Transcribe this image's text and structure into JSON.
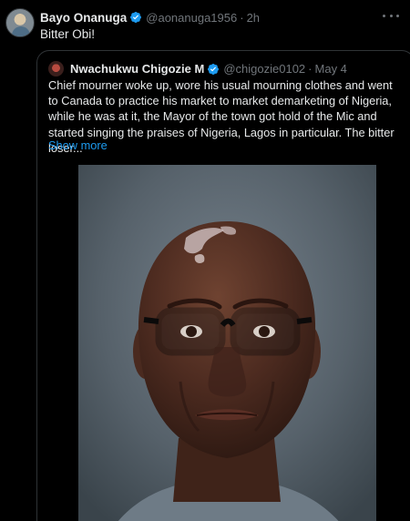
{
  "tweet": {
    "author_name": "Bayo Onanuga",
    "author_handle": "@aonanuga1956",
    "separator": "·",
    "time": "2h",
    "text": "Bitter Obi!"
  },
  "quoted_tweet": {
    "author_name": "Nwachukwu Chigozie M",
    "author_handle": "@chigozie0102",
    "separator": "·",
    "date": "May 4",
    "text": "Chief mourner woke up, wore his usual mourning clothes and went to Canada to practice his market to market demarketing of Nigeria, while he was at it, the Mayor of the town got hold of the Mic and started singing the praises of Nigeria, Lagos in particular. The bitter loser...",
    "show_more_label": "Show more"
  },
  "colors": {
    "background": "#000000",
    "text": "#e7e9ea",
    "muted": "#71767b",
    "accent": "#1d9bf0",
    "border": "#2f3336"
  },
  "icons": {
    "verified": "verified-badge-icon",
    "more": "more-options-icon"
  }
}
